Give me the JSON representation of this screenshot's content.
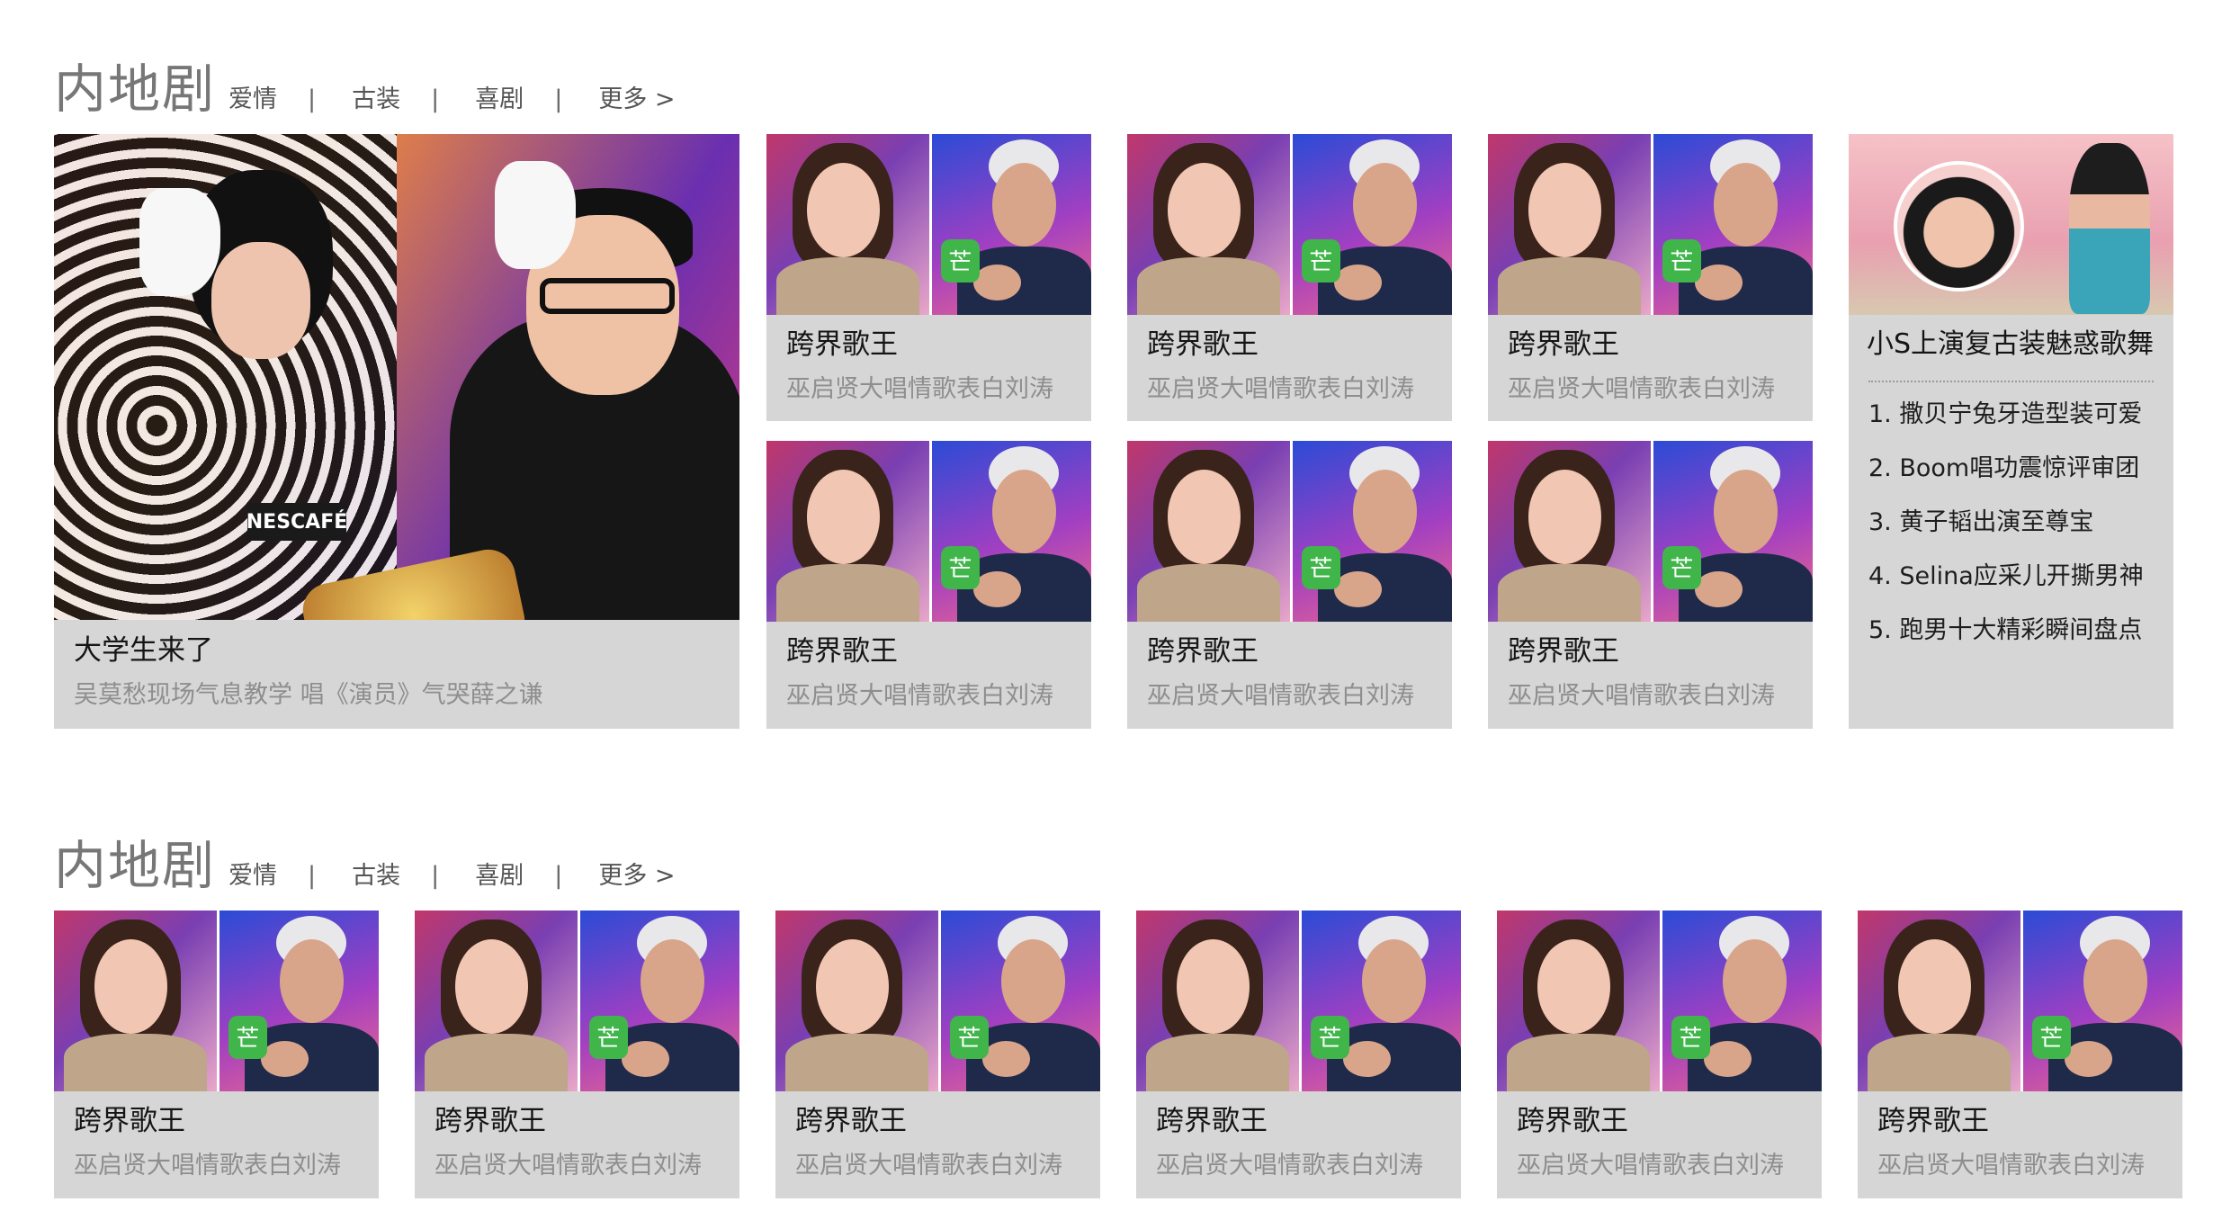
{
  "sections": [
    {
      "title": "内地剧",
      "tabs": [
        "爱情",
        "古装",
        "喜剧",
        "更多 >"
      ],
      "separator": "|"
    },
    {
      "title": "内地剧",
      "tabs": [
        "爱情",
        "古装",
        "喜剧",
        "更多 >"
      ],
      "separator": "|"
    }
  ],
  "feature": {
    "title": "大学生来了",
    "subtitle": "吴莫愁现场气息教学 唱《演员》气哭薛之谦",
    "logo_text": "NESCAFÉ"
  },
  "card": {
    "title": "跨界歌王",
    "subtitle": "巫启贤大唱情歌表白刘涛",
    "badge": "芒"
  },
  "sidebar": {
    "title": "小S上演复古装魅惑歌舞",
    "items": [
      "1. 撒贝宁兔牙造型装可爱",
      "2. Boom唱功震惊评审团",
      "3. 黄子韬出演至尊宝",
      "4. Selina应采儿开撕男神",
      "5. 跑男十大精彩瞬间盘点"
    ]
  },
  "colors": {
    "card_bg": "#d6d6d6",
    "title_gray": "#777777",
    "subtitle_gray": "#8e8e8e"
  }
}
